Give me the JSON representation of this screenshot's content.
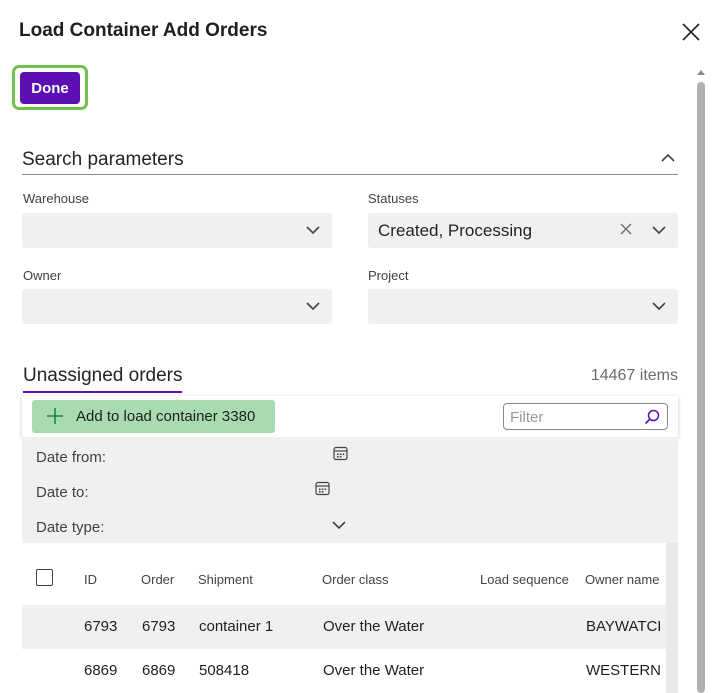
{
  "dialog": {
    "title": "Load Container Add Orders",
    "done_label": "Done"
  },
  "search": {
    "section_title": "Search parameters",
    "warehouse": {
      "label": "Warehouse",
      "value": ""
    },
    "statuses": {
      "label": "Statuses",
      "value": "Created, Processing"
    },
    "owner": {
      "label": "Owner",
      "value": ""
    },
    "project": {
      "label": "Project",
      "value": ""
    }
  },
  "orders": {
    "tab_label": "Unassigned orders",
    "items_count": "14467 items",
    "add_button_label": "Add to load container 3380",
    "filter_placeholder": "Filter",
    "date_from_label": "Date from:",
    "date_to_label": "Date to:",
    "date_type_label": "Date type:",
    "columns": [
      "ID",
      "Order",
      "Shipment",
      "Order class",
      "Load sequence",
      "Owner name"
    ],
    "rows": [
      {
        "id": "6793",
        "order": "6793",
        "shipment": "container 1",
        "order_class": "Over the Water",
        "load_sequence": "",
        "owner_name": "BAYWATCH SE"
      },
      {
        "id": "6869",
        "order": "6869",
        "shipment": "508418",
        "order_class": "Over the Water",
        "load_sequence": "",
        "owner_name": "WESTERN ALA"
      }
    ]
  },
  "colors": {
    "accent": "#5c0fb3",
    "add_button": "#a8dcb0",
    "focus_ring": "#6cc24a",
    "field_bg": "#f0f0f0"
  },
  "icons": {
    "close": "close-icon",
    "collapse": "chevron-up-icon",
    "dropdown": "chevron-down-icon",
    "clear": "clear-icon",
    "add": "plus-icon",
    "search": "search-icon",
    "calendar": "calendar-icon"
  }
}
